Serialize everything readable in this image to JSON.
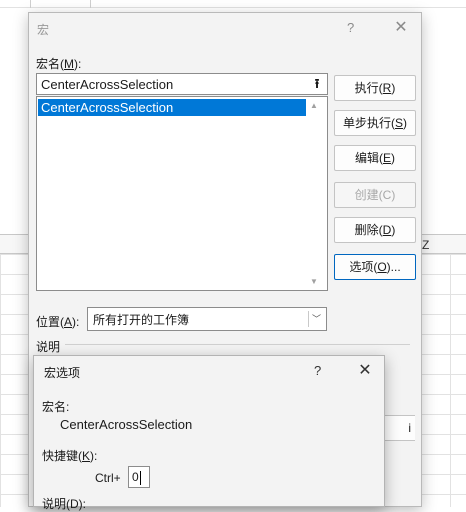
{
  "macro_dialog": {
    "title": "宏",
    "help_glyph": "?",
    "close_glyph": "✕",
    "macro_name_label": "宏名(",
    "macro_name_key": "M",
    "macro_name_label_end": "):",
    "macro_name_value": "CenterAcrossSelection",
    "upload_glyph": "⭱",
    "macro_list": [
      "CenterAcrossSelection"
    ],
    "buttons": {
      "run": {
        "label": "执行(",
        "key": "R",
        "end": ")"
      },
      "step_into": {
        "label": "单步执行(",
        "key": "S",
        "end": ")"
      },
      "edit": {
        "label": "编辑(",
        "key": "E",
        "end": ")"
      },
      "create": {
        "label": "创建(C)"
      },
      "delete": {
        "label": "删除(",
        "key": "D",
        "end": ")"
      },
      "options": {
        "label": "选项(",
        "key": "O",
        "end": ")..."
      }
    },
    "location_label": "位置(",
    "location_key": "A",
    "location_label_end": "):",
    "location_value": "所有打开的工作簿",
    "description_label": "说明",
    "partial_button_text": "i"
  },
  "options_dialog": {
    "title": "宏选项",
    "help_glyph": "?",
    "close_glyph": "✕",
    "macro_name_label": "宏名:",
    "macro_name_value": "CenterAcrossSelection",
    "shortcut_label": "快捷键(",
    "shortcut_key": "K",
    "shortcut_label_end": "):",
    "ctrl_prefix": "Ctrl+",
    "shortcut_value": "0",
    "description_label": "说明(D):"
  },
  "sheet": {
    "column_label": "Z",
    "top_partial_text": "宏"
  }
}
